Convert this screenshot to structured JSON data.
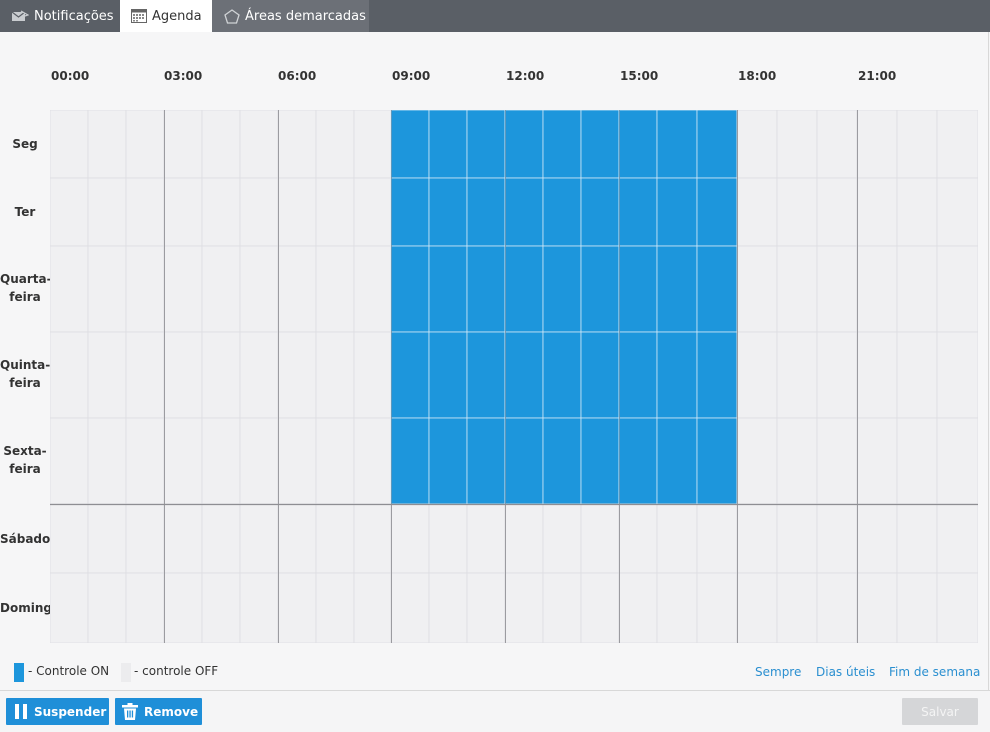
{
  "tabs": {
    "notificacoes": "Notificações",
    "agenda": "Agenda",
    "areas": "Áreas demarcadas"
  },
  "hours": [
    "00:00",
    "03:00",
    "06:00",
    "09:00",
    "12:00",
    "15:00",
    "18:00",
    "21:00"
  ],
  "days": [
    "Seg",
    "Ter",
    "Quarta-\nfeira",
    "Quinta-\nfeira",
    "Sexta-\nfeira",
    "Sábado",
    "Domingo"
  ],
  "schedule": {
    "on_color": "#1d96dc",
    "off_color": "#f0f0f2",
    "active_days": [
      "Seg",
      "Ter",
      "Quarta-\nfeira",
      "Quinta-\nfeira",
      "Sexta-\nfeira"
    ],
    "active_start_hour": 9,
    "active_end_hour": 18
  },
  "legend": {
    "on_label": "- Controle ON",
    "off_label": "- controle OFF"
  },
  "presets": {
    "sempre": "Sempre",
    "dias_uteis": "Dias úteis",
    "fim_de_semana": "Fim de semana"
  },
  "buttons": {
    "suspend": "Suspender",
    "remove": "Remove",
    "save": "Salvar"
  }
}
